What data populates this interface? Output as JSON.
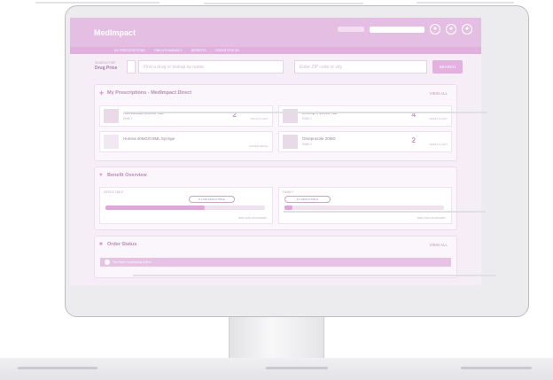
{
  "app": {
    "logo": "MedImpact"
  },
  "header": {
    "user_line": "",
    "search_placeholder": ""
  },
  "subnav": {
    "items": [
      "MY PRESCRIPTIONS",
      "FIND A PHARMACY",
      "BENEFITS",
      "ORDER STATUS"
    ]
  },
  "search": {
    "small_label": "SEARCH FOR",
    "label": "Drug Price",
    "input_placeholder": "Find a drug or lookup by name",
    "location_placeholder": "Enter ZIP code or city",
    "button_label": "SEARCH"
  },
  "prescriptions": {
    "title": "My Prescriptions - MedImpact Direct",
    "view_all": "VIEW ALL",
    "items": [
      {
        "name": "Atorvastatin 20MG Tab",
        "sub": "Refill 1",
        "count": "2",
        "count_label": "REFILLS LEFT"
      },
      {
        "name": "Lisinopril 10MG Tab",
        "sub": "Refill 2",
        "count": "4",
        "count_label": "REFILLS LEFT"
      },
      {
        "name": "Humira 40MG/0.8ML Syringe",
        "sub": "",
        "count": "",
        "count_label": "ORDER REFILL"
      },
      {
        "name": "Omeprazole 20MG",
        "sub": "Refill 0",
        "count": "2",
        "count_label": "REFILLS LEFT"
      }
    ]
  },
  "benefits": {
    "title": "Benefit Overview",
    "boxes": [
      {
        "label": "DEDUCTIBLE",
        "pill": "$ 1,500 DEDUCTIBLE",
        "progress": 0.62,
        "footer": "MAX OUT-OF-POCKET"
      },
      {
        "label": "FAMILY",
        "pill": "$ 0 DEDUCTIBLE",
        "progress": 0.05,
        "footer": "MAX OUT-OF-POCKET"
      }
    ]
  },
  "orders": {
    "title": "Order Status",
    "view_all": "VIEW ALL",
    "banner": "You have no pending orders"
  },
  "colors": {
    "accent": "#e2b1e0",
    "header": "#e5bfe3",
    "frame": "#ececee"
  }
}
